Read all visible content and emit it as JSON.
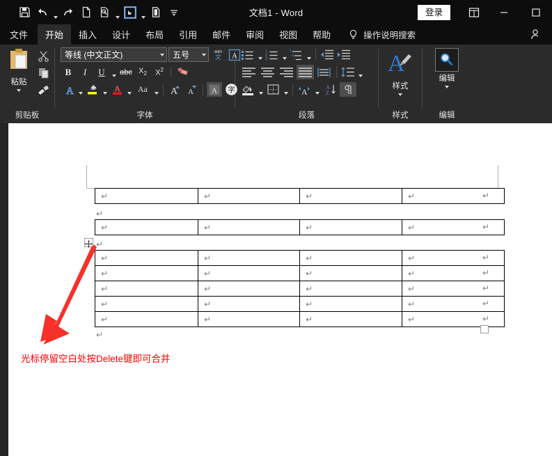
{
  "window": {
    "title": "文档1  -  Word",
    "signin_label": "登录",
    "minimize": "—",
    "maximize": "☐",
    "ribbon_display_icon": "ribbon-display-options-icon"
  },
  "quick_access": [
    {
      "name": "save-icon",
      "label": "保存"
    },
    {
      "name": "undo-icon",
      "label": "撤消",
      "has_caret": true
    },
    {
      "name": "redo-icon",
      "label": "恢复"
    },
    {
      "name": "new-doc-icon",
      "label": "新建"
    },
    {
      "name": "quick-print-icon",
      "label": "快速打印",
      "has_caret": true
    },
    {
      "name": "touch-mouse-mode-icon",
      "label": "触摸/鼠标模式",
      "has_caret": true,
      "boxed": true
    },
    {
      "name": "print-preview-icon",
      "label": "打印预览和打印"
    },
    {
      "name": "customize-qat-icon",
      "label": "自定义快速访问工具栏"
    }
  ],
  "tabs": [
    {
      "label": "文件",
      "active": false
    },
    {
      "label": "开始",
      "active": true
    },
    {
      "label": "插入",
      "active": false
    },
    {
      "label": "设计",
      "active": false
    },
    {
      "label": "布局",
      "active": false
    },
    {
      "label": "引用",
      "active": false
    },
    {
      "label": "邮件",
      "active": false
    },
    {
      "label": "审阅",
      "active": false
    },
    {
      "label": "视图",
      "active": false
    },
    {
      "label": "帮助",
      "active": false
    }
  ],
  "tell_me": {
    "placeholder": "操作说明搜索",
    "icon": "lightbulb-icon"
  },
  "ribbon": {
    "clipboard": {
      "label": "剪贴板",
      "paste_label": "粘贴",
      "paste_icon": "clipboard-icon",
      "cut_icon": "scissors-icon",
      "copy_icon": "copy-icon",
      "format_painter_icon": "format-painter-icon"
    },
    "font": {
      "label": "字体",
      "font_name": "等线 (中文正文)",
      "font_size": "五号",
      "phonetic_guide_icon": "phonetic-guide-icon",
      "char_border_icon": "character-border-icon",
      "bold": "B",
      "italic": "I",
      "underline": "U",
      "strikethrough": "abc",
      "subscript": "X₂",
      "superscript": "X²",
      "clear_format_icon": "clear-formatting-icon",
      "text_effects": "A",
      "highlight": "ab",
      "font_color": "A",
      "change_case": "Aa",
      "grow_font": "A",
      "shrink_font": "A",
      "char_shading_icon": "character-shading-icon",
      "enclose_char_icon": "enclose-characters-icon"
    },
    "paragraph": {
      "label": "段落",
      "bullets_icon": "bullet-list-icon",
      "numbering_icon": "numbered-list-icon",
      "multilevel_icon": "multilevel-list-icon",
      "decrease_indent_icon": "decrease-indent-icon",
      "increase_indent_icon": "increase-indent-icon",
      "align_left_icon": "align-left-icon",
      "align_center_icon": "align-center-icon",
      "align_right_icon": "align-right-icon",
      "justify_icon": "justify-icon",
      "distributed_icon": "distributed-align-icon",
      "line_spacing_icon": "line-spacing-icon",
      "shading_icon": "shading-icon",
      "borders_icon": "borders-icon",
      "asian_layout_icon": "asian-layout-icon",
      "sort_icon": "sort-icon",
      "show_marks_icon": "show-formatting-marks-icon"
    },
    "styles": {
      "label": "样式",
      "button_label": "样式",
      "icon": "styles-icon"
    },
    "editing": {
      "label": "编辑",
      "button_label": "编辑",
      "icon": "find-magnifier-icon"
    }
  },
  "document": {
    "paragraph_mark": "↵",
    "tables": [
      {
        "name": "table-1",
        "rows": 1,
        "columns": 4
      },
      {
        "name": "table-2",
        "rows": 1,
        "columns": 4
      },
      {
        "name": "table-3",
        "rows": 5,
        "columns": 4
      }
    ],
    "standalone_paragraphs": 3,
    "table_move_handle": "table-move-handle",
    "table_resize_handle": "table-resize-handle",
    "annotation": "光标停留空白处按Delete键即可合并",
    "annotation_color": "#ff0000",
    "arrow_color": "#f8302a"
  }
}
